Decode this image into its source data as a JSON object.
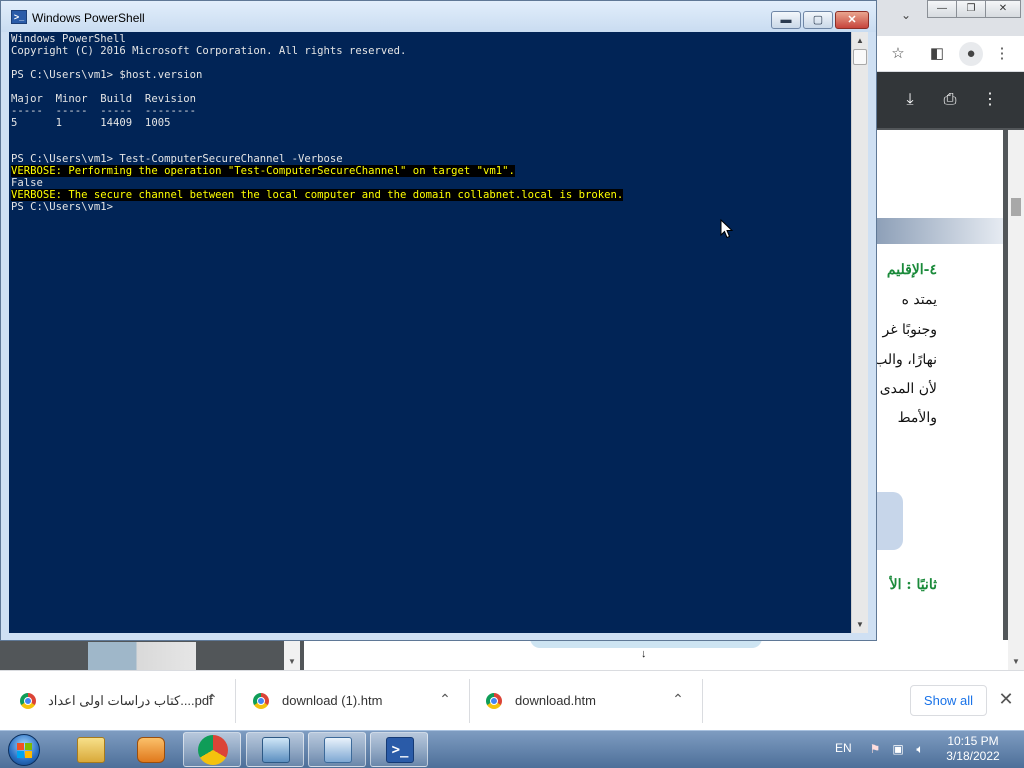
{
  "powershell": {
    "title": "Windows PowerShell",
    "buttons": {
      "minimize": "▬",
      "maximize": "▢",
      "close": "✕"
    },
    "console_lines": [
      {
        "text": "Windows PowerShell",
        "verbose": false
      },
      {
        "text": "Copyright (C) 2016 Microsoft Corporation. All rights reserved.",
        "verbose": false
      },
      {
        "text": "",
        "verbose": false
      },
      {
        "text": "PS C:\\Users\\vm1> $host.version",
        "verbose": false
      },
      {
        "text": "",
        "verbose": false
      },
      {
        "text": "Major  Minor  Build  Revision",
        "verbose": false
      },
      {
        "text": "-----  -----  -----  --------",
        "verbose": false
      },
      {
        "text": "5      1      14409  1005",
        "verbose": false
      },
      {
        "text": "",
        "verbose": false
      },
      {
        "text": "",
        "verbose": false
      },
      {
        "text": "PS C:\\Users\\vm1> Test-ComputerSecureChannel -Verbose",
        "verbose": false
      },
      {
        "text": "VERBOSE: Performing the operation \"Test-ComputerSecureChannel\" on target \"vm1\".",
        "verbose": true
      },
      {
        "text": "False",
        "verbose": false
      },
      {
        "text": "VERBOSE: The secure channel between the local computer and the domain collabnet.local is broken.",
        "verbose": true
      },
      {
        "text": "PS C:\\Users\\vm1>",
        "verbose": false
      }
    ],
    "colors": {
      "console_bg": "#012456",
      "text": "#e5e5e5",
      "verbose_fg": "#ffff00",
      "verbose_bg": "#000000"
    }
  },
  "chrome": {
    "pdf_page_lines": [
      {
        "text": "٤-الإقليم",
        "heading": true
      },
      {
        "text": "يمتد ه",
        "heading": false
      },
      {
        "text": "وجنوبًا غر",
        "heading": false
      },
      {
        "text": "نهارًا، والب",
        "heading": false
      },
      {
        "text": "لأن المدى ا",
        "heading": false
      },
      {
        "text": "والأمط",
        "heading": false
      },
      {
        "text": "ثانيًا : الأ",
        "heading": true
      }
    ]
  },
  "downloads": {
    "items": [
      {
        "name": "كتاب دراسات اولى اعداد....pdf"
      },
      {
        "name": "download (1).htm"
      },
      {
        "name": "download.htm"
      }
    ],
    "show_all": "Show all",
    "close": "✕"
  },
  "taskbar": {
    "language": "EN",
    "time": "10:15 PM",
    "date": "3/18/2022"
  }
}
